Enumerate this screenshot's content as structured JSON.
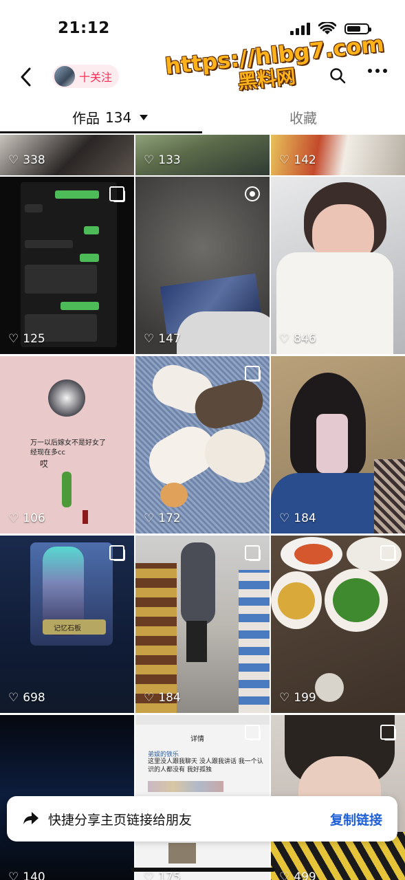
{
  "status_bar": {
    "time": "21:12"
  },
  "header": {
    "follow_label": "十关注",
    "watermark_url": "https://hlbg7.com",
    "watermark_name": "黑料网"
  },
  "tabs": {
    "works_label": "作品",
    "works_count": "134",
    "favorites_label": "收藏"
  },
  "grid": {
    "items": [
      {
        "likes": "338"
      },
      {
        "likes": "133"
      },
      {
        "likes": "142"
      },
      {
        "likes": "125"
      },
      {
        "likes": "147"
      },
      {
        "likes": "846"
      },
      {
        "likes": "106"
      },
      {
        "likes": "172"
      },
      {
        "likes": "184"
      },
      {
        "likes": "698"
      },
      {
        "likes": "184"
      },
      {
        "likes": "199"
      },
      {
        "likes": "140"
      },
      {
        "likes": "175"
      },
      {
        "likes": "499"
      }
    ]
  },
  "post_text": {
    "pink_caption": "万一以后嫁女不是好女了 经现在多cc",
    "pink_sigh": "哎",
    "card_label": "记忆石板",
    "detail_title": "详情",
    "detail_user": "弟娱的铁乐",
    "detail_body": "这里没人跟我聊天 没人跟我讲话 我一个认识的人都没有 我好孤独"
  },
  "share_bar": {
    "label": "快捷分享主页链接给朋友",
    "copy_label": "复制链接"
  }
}
